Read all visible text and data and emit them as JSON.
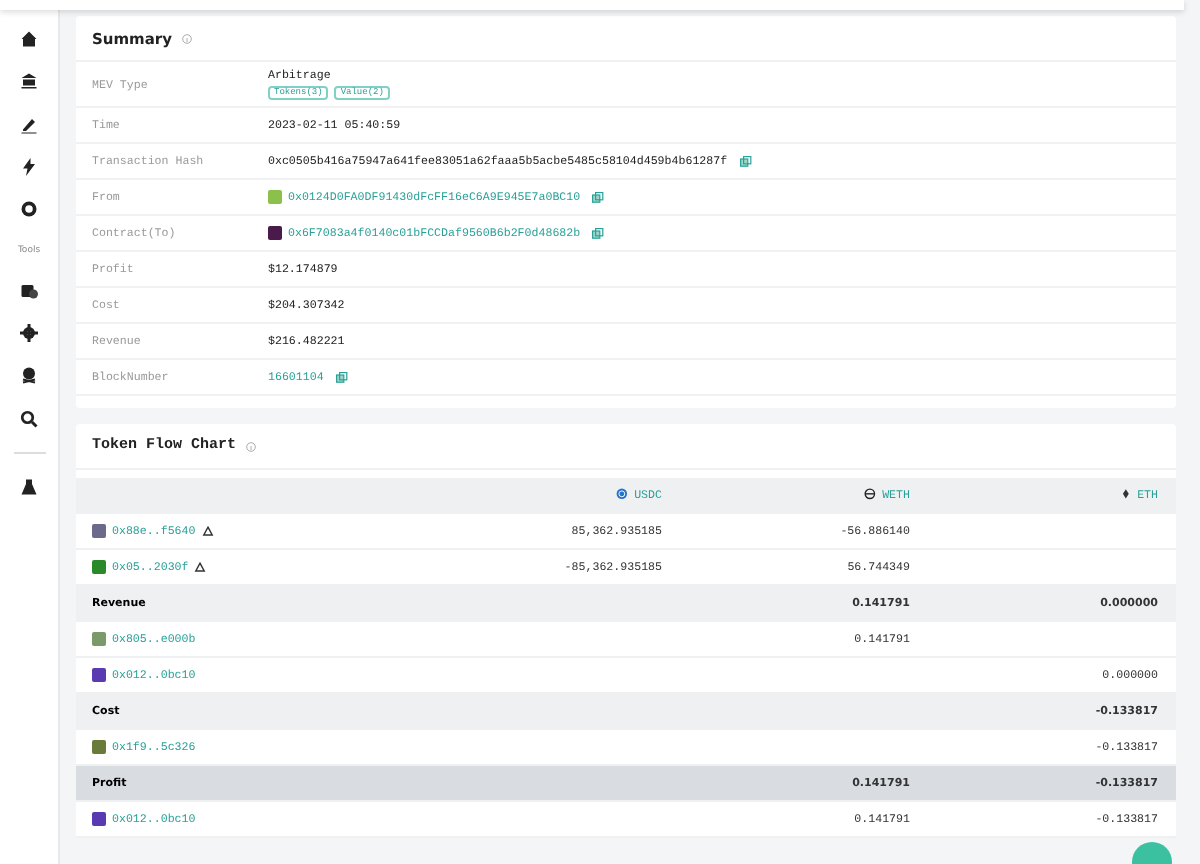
{
  "sidebar": {
    "tools_label": "Tools"
  },
  "summary": {
    "title": "Summary",
    "rows": [
      {
        "label": "MEV Type",
        "kind": "type",
        "value": "Arbitrage",
        "tags": [
          "Tokens(3)",
          "Value(2)"
        ]
      },
      {
        "label": "Time",
        "kind": "text",
        "value": "2023-02-11 05:40:59"
      },
      {
        "label": "Transaction Hash",
        "kind": "hash",
        "value": "0xc0505b416a75947a641fee83051a62faaa5b5acbe5485c58104d459b4b61287f"
      },
      {
        "label": "From",
        "kind": "address",
        "value": "0x0124D0FA0DF91430dFcFF16eC6A9E945E7a0BC10",
        "color": "#8cc04c"
      },
      {
        "label": "Contract(To)",
        "kind": "address",
        "value": "0x6F7083a4f0140c01bFCCDaf9560B6b2F0d48682b",
        "color": "#4a1a4a"
      },
      {
        "label": "Profit",
        "kind": "text",
        "value": "$12.174879"
      },
      {
        "label": "Cost",
        "kind": "text",
        "value": "$204.307342"
      },
      {
        "label": "Revenue",
        "kind": "text",
        "value": "$216.482221"
      },
      {
        "label": "BlockNumber",
        "kind": "link",
        "value": "16601104"
      }
    ]
  },
  "token_flow": {
    "title": "Token Flow Chart",
    "columns": [
      "USDC",
      "WETH",
      "ETH"
    ],
    "rows": [
      {
        "kind": "address",
        "name": "0x88e..f5640",
        "color": "#6b6a8a",
        "swap_mark": true,
        "usdc": "85,362.935185",
        "weth": "-56.886140"
      },
      {
        "kind": "address",
        "name": "0x05..2030f",
        "color": "#2a8a2a",
        "swap_mark": true,
        "usdc": "-85,362.935185",
        "weth": "56.744349"
      },
      {
        "kind": "group",
        "name": "Revenue",
        "weth": "0.141791",
        "eth": "0.000000"
      },
      {
        "kind": "address",
        "name": "0x805..e000b",
        "color": "#7a9a6a",
        "swap_mark": false,
        "weth": "0.141791"
      },
      {
        "kind": "address",
        "name": "0x012..0bc10",
        "color": "#5a3ab0",
        "swap_mark": false,
        "eth": "0.000000"
      },
      {
        "kind": "group",
        "name": "Cost",
        "eth": "-0.133817"
      },
      {
        "kind": "address",
        "name": "0x1f9..5c326",
        "color": "#6a7a3a",
        "swap_mark": false,
        "eth": "-0.133817"
      },
      {
        "kind": "total",
        "name": "Profit",
        "weth": "0.141791",
        "eth": "-0.133817"
      },
      {
        "kind": "address",
        "name": "0x012..0bc10",
        "color": "#5a3ab0",
        "swap_mark": false,
        "weth": "0.141791",
        "eth": "-0.133817"
      }
    ]
  }
}
